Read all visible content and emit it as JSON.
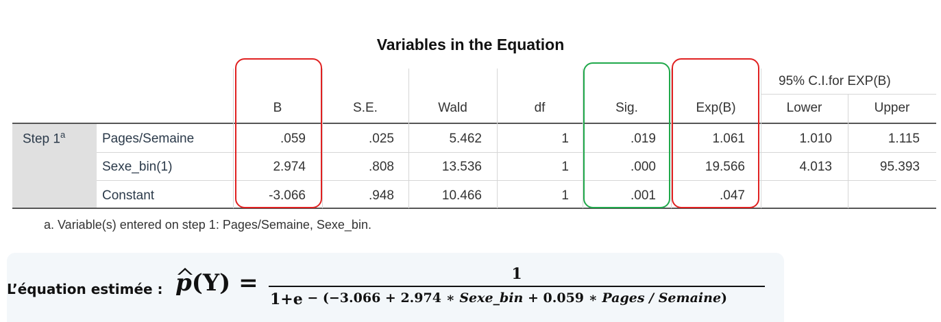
{
  "table": {
    "title": "Variables in the Equation",
    "ci_header": "95% C.I.for EXP(B)",
    "columns": [
      "B",
      "S.E.",
      "Wald",
      "df",
      "Sig.",
      "Exp(B)",
      "Lower",
      "Upper"
    ],
    "step_label": "Step 1",
    "step_superscript": "a",
    "rows": [
      {
        "label": "Pages/Semaine",
        "values": [
          ".059",
          ".025",
          "5.462",
          "1",
          ".019",
          "1.061",
          "1.010",
          "1.115"
        ]
      },
      {
        "label": "Sexe_bin(1)",
        "values": [
          "2.974",
          ".808",
          "13.536",
          "1",
          ".000",
          "19.566",
          "4.013",
          "95.393"
        ]
      },
      {
        "label": "Constant",
        "values": [
          "-3.066",
          ".948",
          "10.466",
          "1",
          ".001",
          ".047",
          "",
          ""
        ]
      }
    ],
    "footnote": "a. Variable(s) entered on step 1: Pages/Semaine, Sexe_bin."
  },
  "highlight_colors": {
    "red": "#e02020",
    "green": "#1fa84a"
  },
  "equation": {
    "label": "L’équation estimée :",
    "lhs_p": "p",
    "lhs_rest": "(Y) =",
    "numerator": "1",
    "den_base": "1+e",
    "den_exp_pre": " − (−3.066 + 2.974 ∗ ",
    "den_var1": "Sexe_bin",
    "den_exp_mid": " + 0.059 ∗ ",
    "den_var2": "Pages / Semaine",
    "den_exp_post": ")"
  }
}
